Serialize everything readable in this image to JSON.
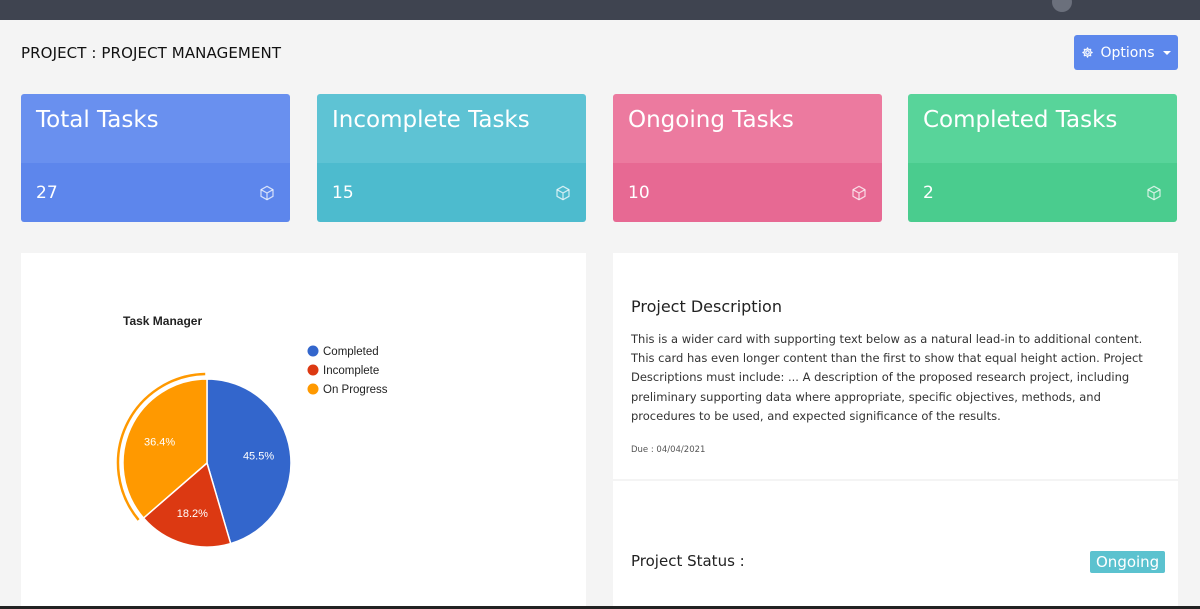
{
  "header": {
    "project_title": "PROJECT : PROJECT MANAGEMENT",
    "options_label": "Options"
  },
  "stats": [
    {
      "title": "Total Tasks",
      "value": "27",
      "icon": "cube-icon",
      "color": "#5d86ec"
    },
    {
      "title": "Incomplete Tasks",
      "value": "15",
      "icon": "cube-icon",
      "color": "#4dbbce"
    },
    {
      "title": "Ongoing Tasks",
      "value": "10",
      "icon": "cube-icon",
      "color": "#e76993"
    },
    {
      "title": "Completed Tasks",
      "value": "2",
      "icon": "cube-icon",
      "color": "#4acc8e"
    }
  ],
  "chart_data": {
    "type": "pie",
    "title": "Task Manager",
    "legend_position": "right",
    "categories": [
      "Completed",
      "Incomplete",
      "On Progress"
    ],
    "values": [
      45.5,
      18.2,
      36.4
    ],
    "labels": [
      "45.5%",
      "18.2%",
      "36.4%"
    ],
    "colors": [
      "#3366cc",
      "#dc3912",
      "#ff9900"
    ],
    "highlighted": "On Progress"
  },
  "description": {
    "title": "Project Description",
    "text": "This is a wider card with supporting text below as a natural lead-in to additional content. This card has even longer content than the first to show that equal height action. Project Descriptions must include: ... A description of the proposed research project, including preliminary supporting data where appropriate, specific objectives, methods, and procedures to be used, and expected significance of the results.",
    "due": "Due : 04/04/2021"
  },
  "status": {
    "label": "Project Status :",
    "value": "Ongoing"
  }
}
